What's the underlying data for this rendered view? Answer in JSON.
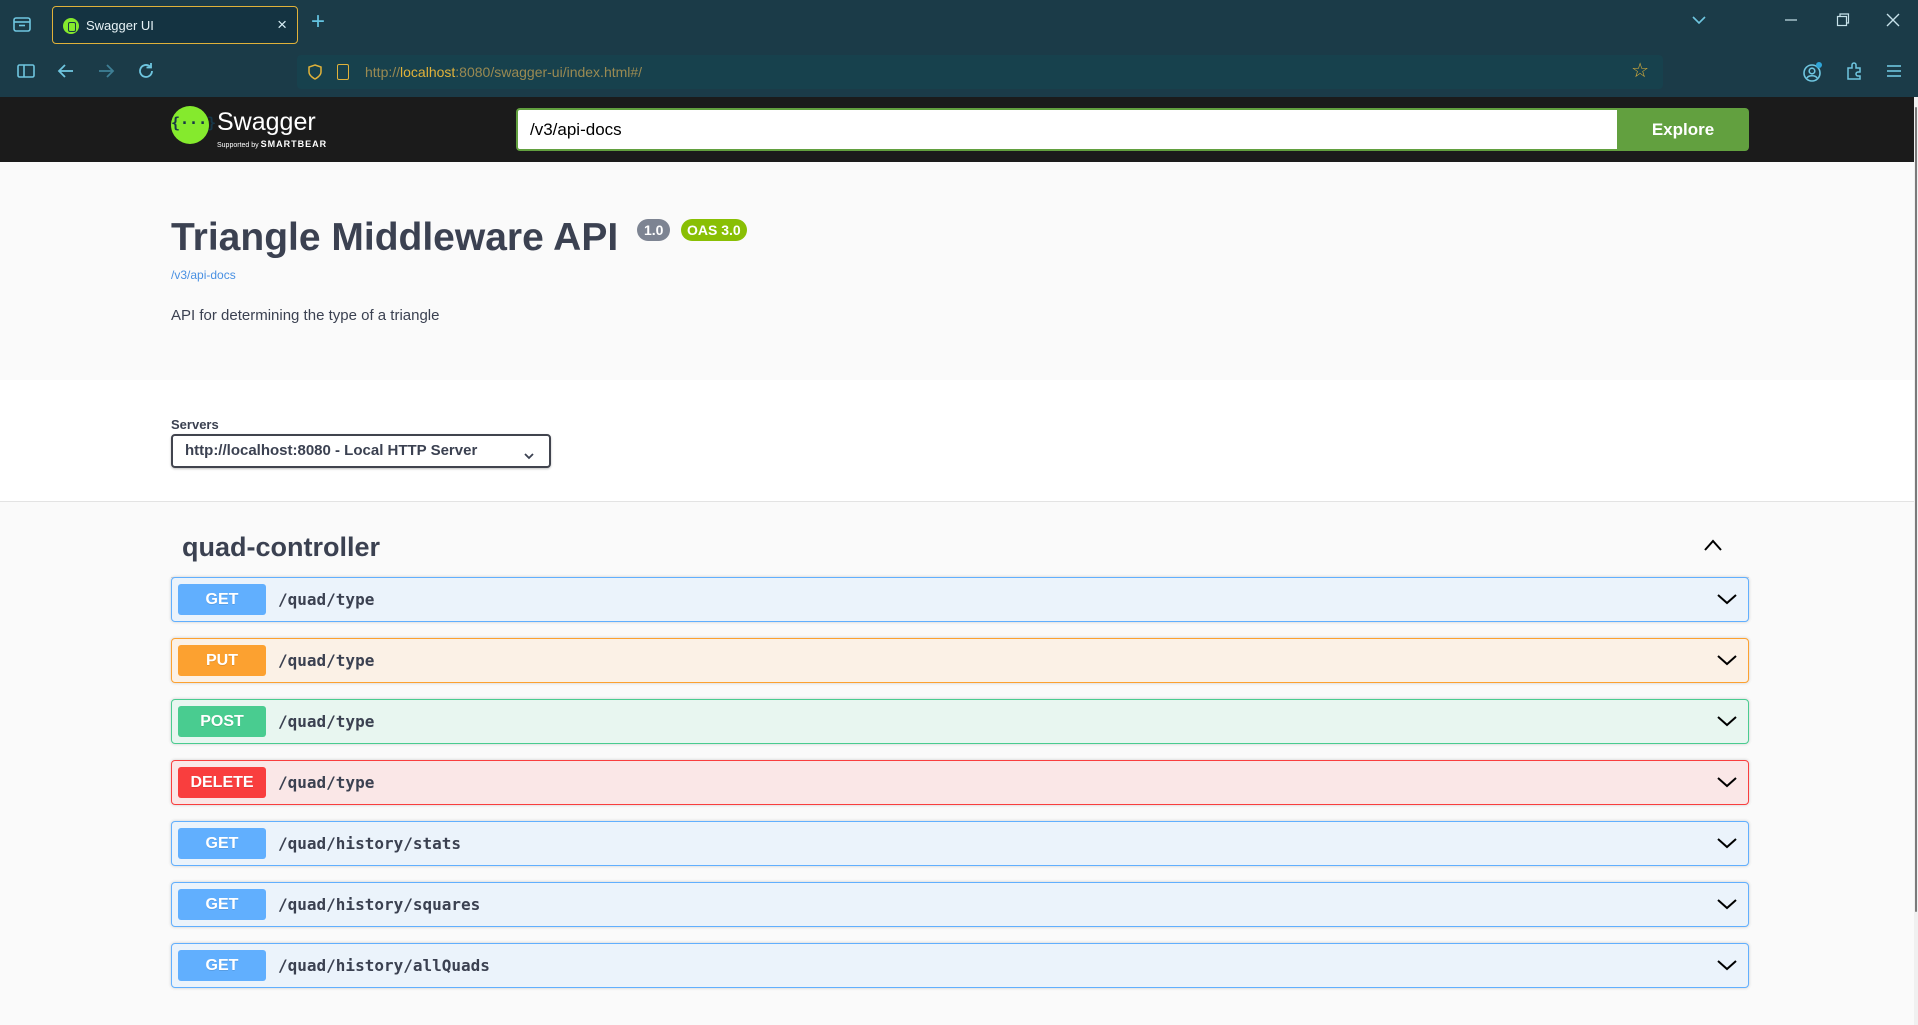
{
  "browser": {
    "tab_title": "Swagger UI",
    "tab_close": "×",
    "new_tab": "+",
    "url_prefix": "http://",
    "url_host": "localhost",
    "url_rest": ":8080/swagger-ui/index.html#/"
  },
  "swagger": {
    "logo_name": "Swagger",
    "logo_sub_prefix": "Supported by ",
    "logo_sub_brand": "SMARTBEAR",
    "spec_url": "/v3/api-docs",
    "explore_label": "Explore"
  },
  "info": {
    "title": "Triangle Middleware API",
    "version": "1.0",
    "oas": "OAS 3.0",
    "link": "/v3/api-docs",
    "description": "API for determining the type of a triangle"
  },
  "servers": {
    "label": "Servers",
    "selected": "http://localhost:8080 - Local HTTP Server"
  },
  "tag": {
    "name": "quad-controller"
  },
  "operations": [
    {
      "method": "GET",
      "path": "/quad/type"
    },
    {
      "method": "PUT",
      "path": "/quad/type"
    },
    {
      "method": "POST",
      "path": "/quad/type"
    },
    {
      "method": "DELETE",
      "path": "/quad/type"
    },
    {
      "method": "GET",
      "path": "/quad/history/stats"
    },
    {
      "method": "GET",
      "path": "/quad/history/squares"
    },
    {
      "method": "GET",
      "path": "/quad/history/allQuads"
    }
  ],
  "colors": {
    "get": "#61affe",
    "put": "#fca130",
    "post": "#49cc90",
    "delete": "#f93e3e",
    "swagger_green": "#85ea2d",
    "explore_green": "#62a03f"
  }
}
